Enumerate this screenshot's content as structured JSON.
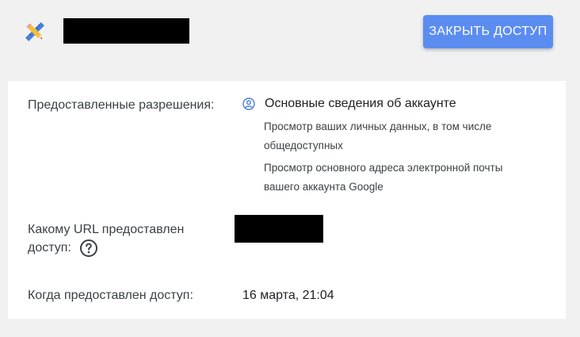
{
  "header": {
    "app_icon": "pencil-ruler-icon",
    "revoke_button_label": "ЗАКРЫТЬ ДОСТУП",
    "accent_color": "#5b8df0"
  },
  "details": {
    "permissions_label": "Предоставленные разрешения:",
    "permission_group_title": "Основные сведения об аккаунте",
    "permission_group_icon": "account-circle-icon",
    "permission_items": [
      "Просмотр ваших личных данных, в том числе общедоступных",
      "Просмотр основного адреса электронной почты вашего аккаунта Google"
    ],
    "url_label": "Какому URL предоставлен доступ:",
    "url_help_icon": "help-circle-icon",
    "granted_label": "Когда предоставлен доступ:",
    "granted_value": "16 марта, 21:04"
  }
}
